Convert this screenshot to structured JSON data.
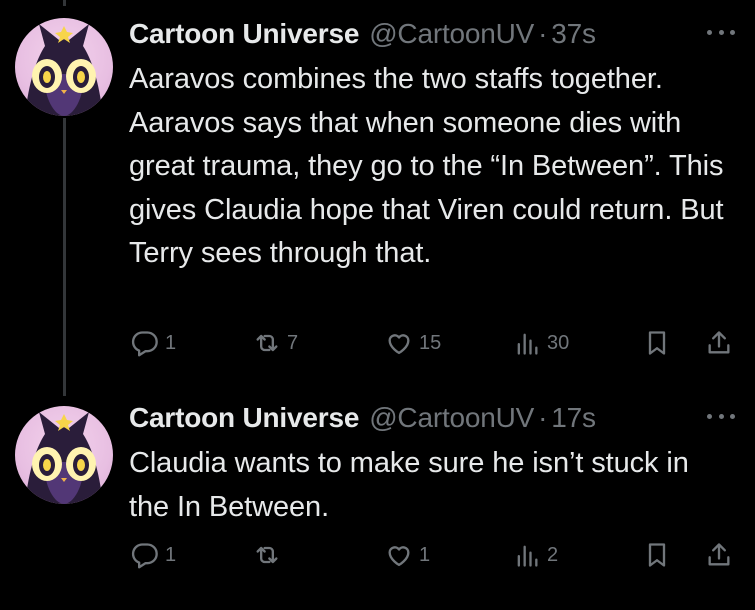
{
  "colors": {
    "background": "#000000",
    "text": "#e7e9ea",
    "muted": "#71767b",
    "thread_line": "#333639"
  },
  "tweets": [
    {
      "name": "Cartoon Universe",
      "handle": "@CartoonUV",
      "separator": "·",
      "time": "37s",
      "text": "Aaravos combines the two staffs together. Aaravos says that when someone dies with great trauma, they go to the “In Between”. This gives Claudia hope that Viren could return. But Terry sees through that.",
      "replies": "1",
      "reposts": "7",
      "likes": "15",
      "views": "30",
      "icons": [
        "cat-avatar-icon",
        "more-icon",
        "reply-icon",
        "repost-icon",
        "like-icon",
        "views-icon",
        "bookmark-icon",
        "share-icon"
      ]
    },
    {
      "name": "Cartoon Universe",
      "handle": "@CartoonUV",
      "separator": "·",
      "time": "17s",
      "text": "Claudia wants to make sure he isn’t stuck in the In Between.",
      "replies": "1",
      "reposts": "",
      "likes": "1",
      "views": "2",
      "icons": [
        "cat-avatar-icon",
        "more-icon",
        "reply-icon",
        "repost-icon",
        "like-icon",
        "views-icon",
        "bookmark-icon",
        "share-icon"
      ]
    }
  ]
}
